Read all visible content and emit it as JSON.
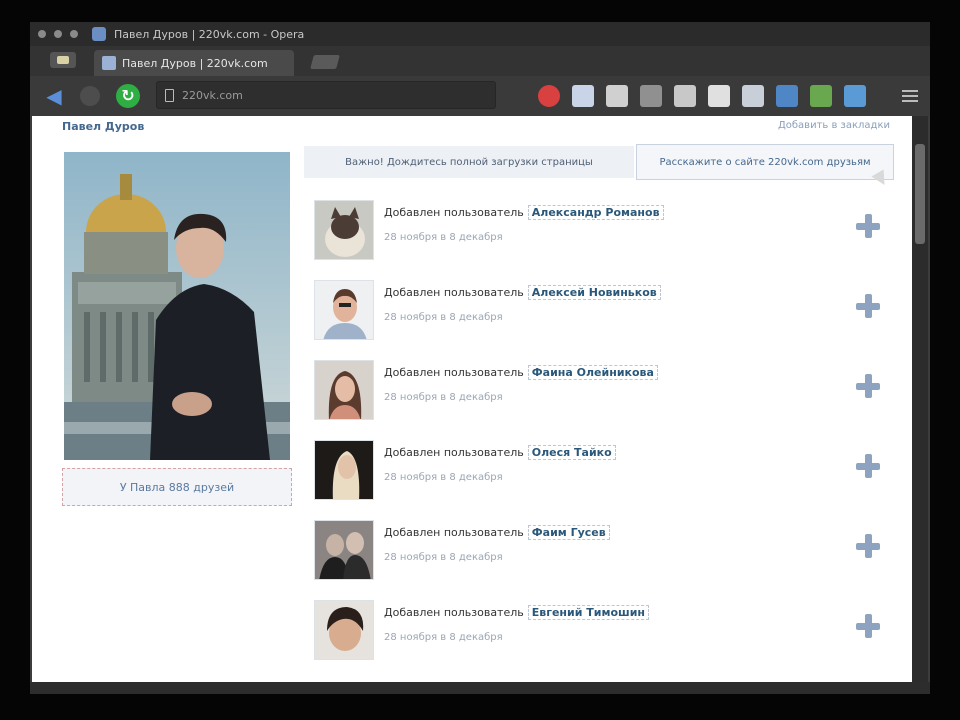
{
  "window": {
    "title": "Павел Дуров | 220vk.com - Opera"
  },
  "tab": {
    "title": "Павел Дуров | 220vk.com"
  },
  "address": {
    "url": "220vk.com"
  },
  "toolbar": {
    "extensions": [
      "#d94040",
      "#c9d4e8",
      "#d0d0d0",
      "#909090",
      "#c8c8c8",
      "#e0e0e0",
      "#c8cfd8",
      "#4f86c6",
      "#6aa84f",
      "#5b9bd5"
    ]
  },
  "profile": {
    "name": "Павел Дуров",
    "top_link": "Добавить в закладки",
    "friends_label": "У Павла 888 друзей"
  },
  "notice": {
    "text": "Важно! Дождитесь полной загрузки страницы"
  },
  "invite": {
    "label": "Расскажите о сайте 220vk.com друзьям"
  },
  "feed": [
    {
      "action": "Добавлен пользователь",
      "user": "Александр Романов",
      "time": "28 ноября в 8 декабря"
    },
    {
      "action": "Добавлен пользователь",
      "user": "Алексей Новиньков",
      "time": "28 ноября в 8 декабря"
    },
    {
      "action": "Добавлен пользователь",
      "user": "Фаина Олейникова",
      "time": "28 ноября в 8 декабря"
    },
    {
      "action": "Добавлен пользователь",
      "user": "Олеся Тайко",
      "time": "28 ноября в 8 декабря"
    },
    {
      "action": "Добавлен пользователь",
      "user": "Фаим Гусев",
      "time": "28 ноября в 8 декабря"
    },
    {
      "action": "Добавлен пользователь",
      "user": "Евгений Тимошин",
      "time": "28 ноября в 8 декабря"
    }
  ]
}
